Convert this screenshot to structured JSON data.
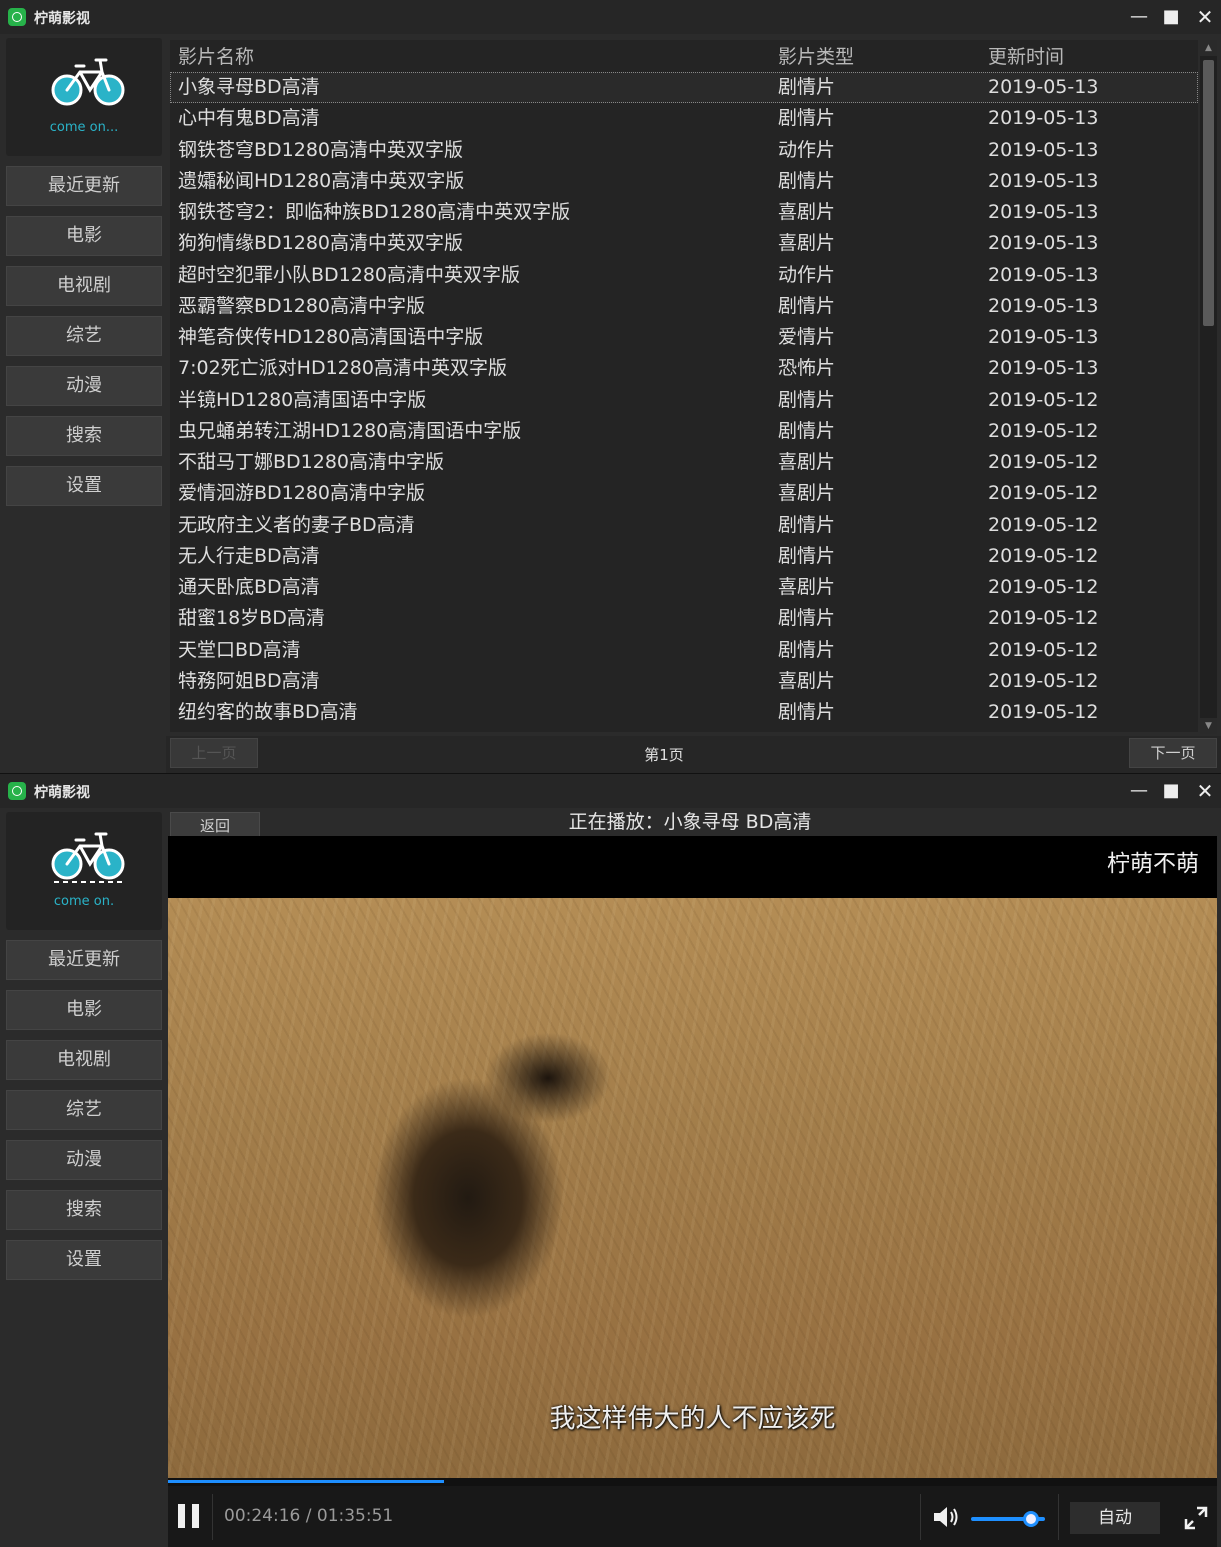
{
  "app": {
    "title": "柠萌影视",
    "logo_text_list": "come on...",
    "logo_text_player": "come on."
  },
  "nav": [
    "最近更新",
    "电影",
    "电视剧",
    "综艺",
    "动漫",
    "搜索",
    "设置"
  ],
  "list": {
    "headers": [
      "影片名称",
      "影片类型",
      "更新时间"
    ],
    "rows": [
      {
        "name": "小象寻母BD高清",
        "type": "剧情片",
        "date": "2019-05-13"
      },
      {
        "name": "心中有鬼BD高清",
        "type": "剧情片",
        "date": "2019-05-13"
      },
      {
        "name": "钢铁苍穹BD1280高清中英双字版",
        "type": "动作片",
        "date": "2019-05-13"
      },
      {
        "name": "遗孀秘闻HD1280高清中英双字版",
        "type": "剧情片",
        "date": "2019-05-13"
      },
      {
        "name": "钢铁苍穹2：即临种族BD1280高清中英双字版",
        "type": "喜剧片",
        "date": "2019-05-13"
      },
      {
        "name": "狗狗情缘BD1280高清中英双字版",
        "type": "喜剧片",
        "date": "2019-05-13"
      },
      {
        "name": "超时空犯罪小队BD1280高清中英双字版",
        "type": "动作片",
        "date": "2019-05-13"
      },
      {
        "name": "恶霸警察BD1280高清中字版",
        "type": "剧情片",
        "date": "2019-05-13"
      },
      {
        "name": "神笔奇侠传HD1280高清国语中字版",
        "type": "爱情片",
        "date": "2019-05-13"
      },
      {
        "name": "7:02死亡派对HD1280高清中英双字版",
        "type": "恐怖片",
        "date": "2019-05-13"
      },
      {
        "name": "半镜HD1280高清国语中字版",
        "type": "剧情片",
        "date": "2019-05-12"
      },
      {
        "name": "虫兄蛹弟转江湖HD1280高清国语中字版",
        "type": "剧情片",
        "date": "2019-05-12"
      },
      {
        "name": "不甜马丁娜BD1280高清中字版",
        "type": "喜剧片",
        "date": "2019-05-12"
      },
      {
        "name": "爱情洄游BD1280高清中字版",
        "type": "喜剧片",
        "date": "2019-05-12"
      },
      {
        "name": "无政府主义者的妻子BD高清",
        "type": "剧情片",
        "date": "2019-05-12"
      },
      {
        "name": "无人行走BD高清",
        "type": "剧情片",
        "date": "2019-05-12"
      },
      {
        "name": "通天卧底BD高清",
        "type": "喜剧片",
        "date": "2019-05-12"
      },
      {
        "name": "甜蜜18岁BD高清",
        "type": "剧情片",
        "date": "2019-05-12"
      },
      {
        "name": "天堂口BD高清",
        "type": "剧情片",
        "date": "2019-05-12"
      },
      {
        "name": "特務阿姐BD高清",
        "type": "喜剧片",
        "date": "2019-05-12"
      },
      {
        "name": "纽约客的故事BD高清",
        "type": "剧情片",
        "date": "2019-05-12"
      }
    ],
    "selected_index": 0,
    "pager": {
      "prev": "上一页",
      "page": "第1页",
      "next": "下一页"
    }
  },
  "player": {
    "back": "返回",
    "now_playing": "正在播放：小象寻母 BD高清",
    "watermark": "柠萌不萌",
    "subtitle": "我这样伟大的人不应该死",
    "time": "00:24:16 / 01:35:51",
    "progress": 0.2627,
    "volume": 0.8,
    "quality": "自动",
    "accent": "#1e8fff"
  }
}
